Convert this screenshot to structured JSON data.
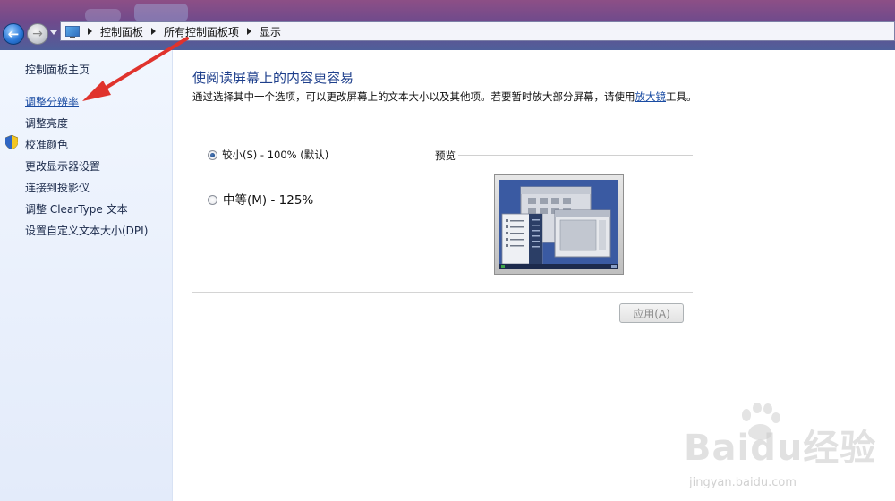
{
  "breadcrumb": {
    "items": [
      "控制面板",
      "所有控制面板项",
      "显示"
    ]
  },
  "sidebar": {
    "items": [
      {
        "label": "控制面板主页"
      },
      {
        "label": "调整分辨率"
      },
      {
        "label": "调整亮度"
      },
      {
        "label": "校准颜色"
      },
      {
        "label": "更改显示器设置"
      },
      {
        "label": "连接到投影仪"
      },
      {
        "label": "调整 ClearType 文本"
      },
      {
        "label": "设置自定义文本大小(DPI)"
      }
    ]
  },
  "main": {
    "title": "使阅读屏幕上的内容更容易",
    "description_part1": "通过选择其中一个选项，可以更改屏幕上的文本大小以及其他项。若要暂时放大部分屏幕，请使用",
    "description_link": "放大镜",
    "description_part2": "工具。",
    "options": [
      {
        "label": "较小(S) - 100% (默认)",
        "selected": true
      },
      {
        "label": "中等(M) - 125%",
        "selected": false
      }
    ],
    "preview_label": "预览",
    "apply_label": "应用(A)"
  },
  "watermark": {
    "brand": "Baidu经验",
    "url": "jingyan.baidu.com"
  },
  "colors": {
    "link": "#1a4ca3",
    "title": "#1e3f8c",
    "annotation_arrow": "#e0332d"
  }
}
